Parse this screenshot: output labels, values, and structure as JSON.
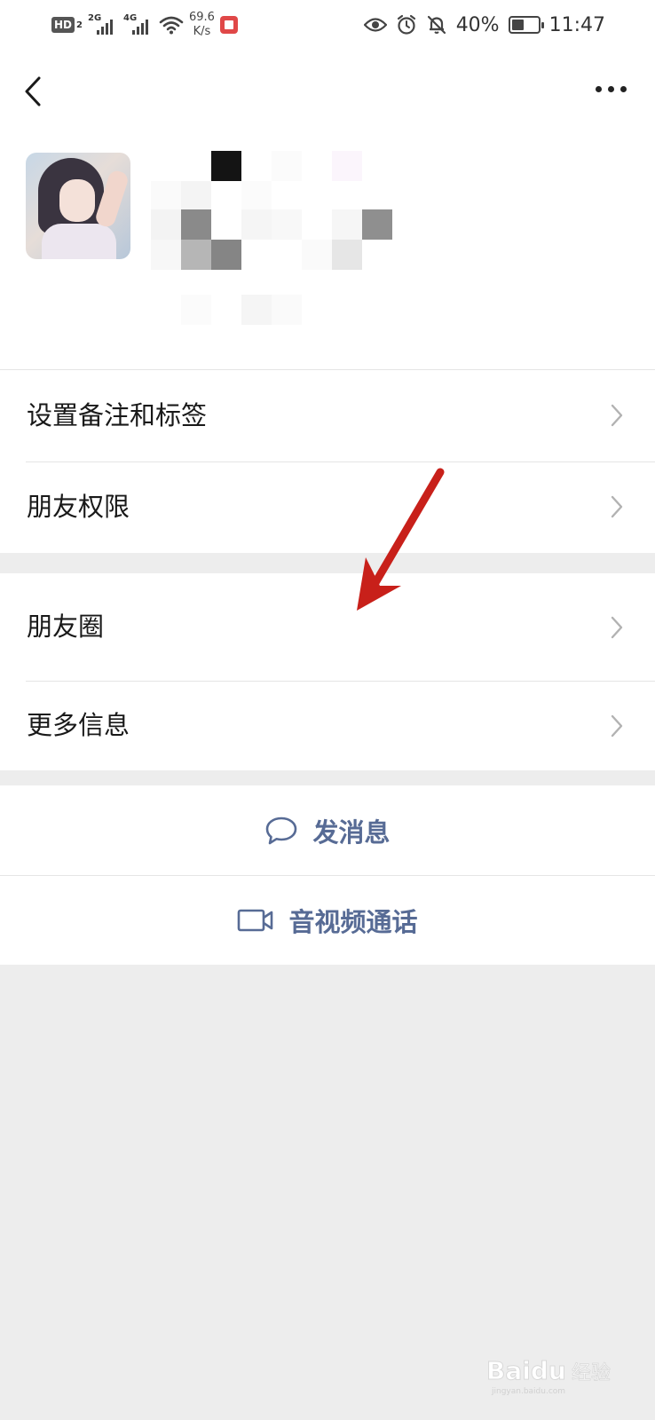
{
  "status_bar": {
    "hd_label": "HD",
    "hd_sub": "2",
    "net1_label": "2G",
    "net2_label": "4G",
    "speed_value": "69.6",
    "speed_unit": "K/s",
    "battery_percent": "40%",
    "time": "11:47",
    "icons": [
      "hd-icon",
      "signal-icon",
      "wifi-icon",
      "app-notification-icon",
      "eye-icon",
      "alarm-icon",
      "mute-bell-icon",
      "battery-icon"
    ]
  },
  "nav": {
    "back_icon": "back-arrow-icon",
    "more_icon": "more-dots-icon"
  },
  "profile": {
    "avatar_icon": "avatar-image"
  },
  "menu": {
    "group1": [
      {
        "label": "设置备注和标签"
      },
      {
        "label": "朋友权限"
      }
    ],
    "group2": [
      {
        "label": "朋友圈"
      },
      {
        "label": "更多信息"
      }
    ],
    "actions": [
      {
        "label": "发消息",
        "icon": "chat-bubble-icon"
      },
      {
        "label": "音视频通话",
        "icon": "video-camera-icon"
      }
    ]
  },
  "colors": {
    "page_bg": "#ededed",
    "card_bg": "#ffffff",
    "link_blue": "#576b95",
    "annotation_red": "#c8201a"
  },
  "watermark": {
    "brand": "Baidu",
    "label": "经验",
    "url": "jingyan.baidu.com"
  }
}
